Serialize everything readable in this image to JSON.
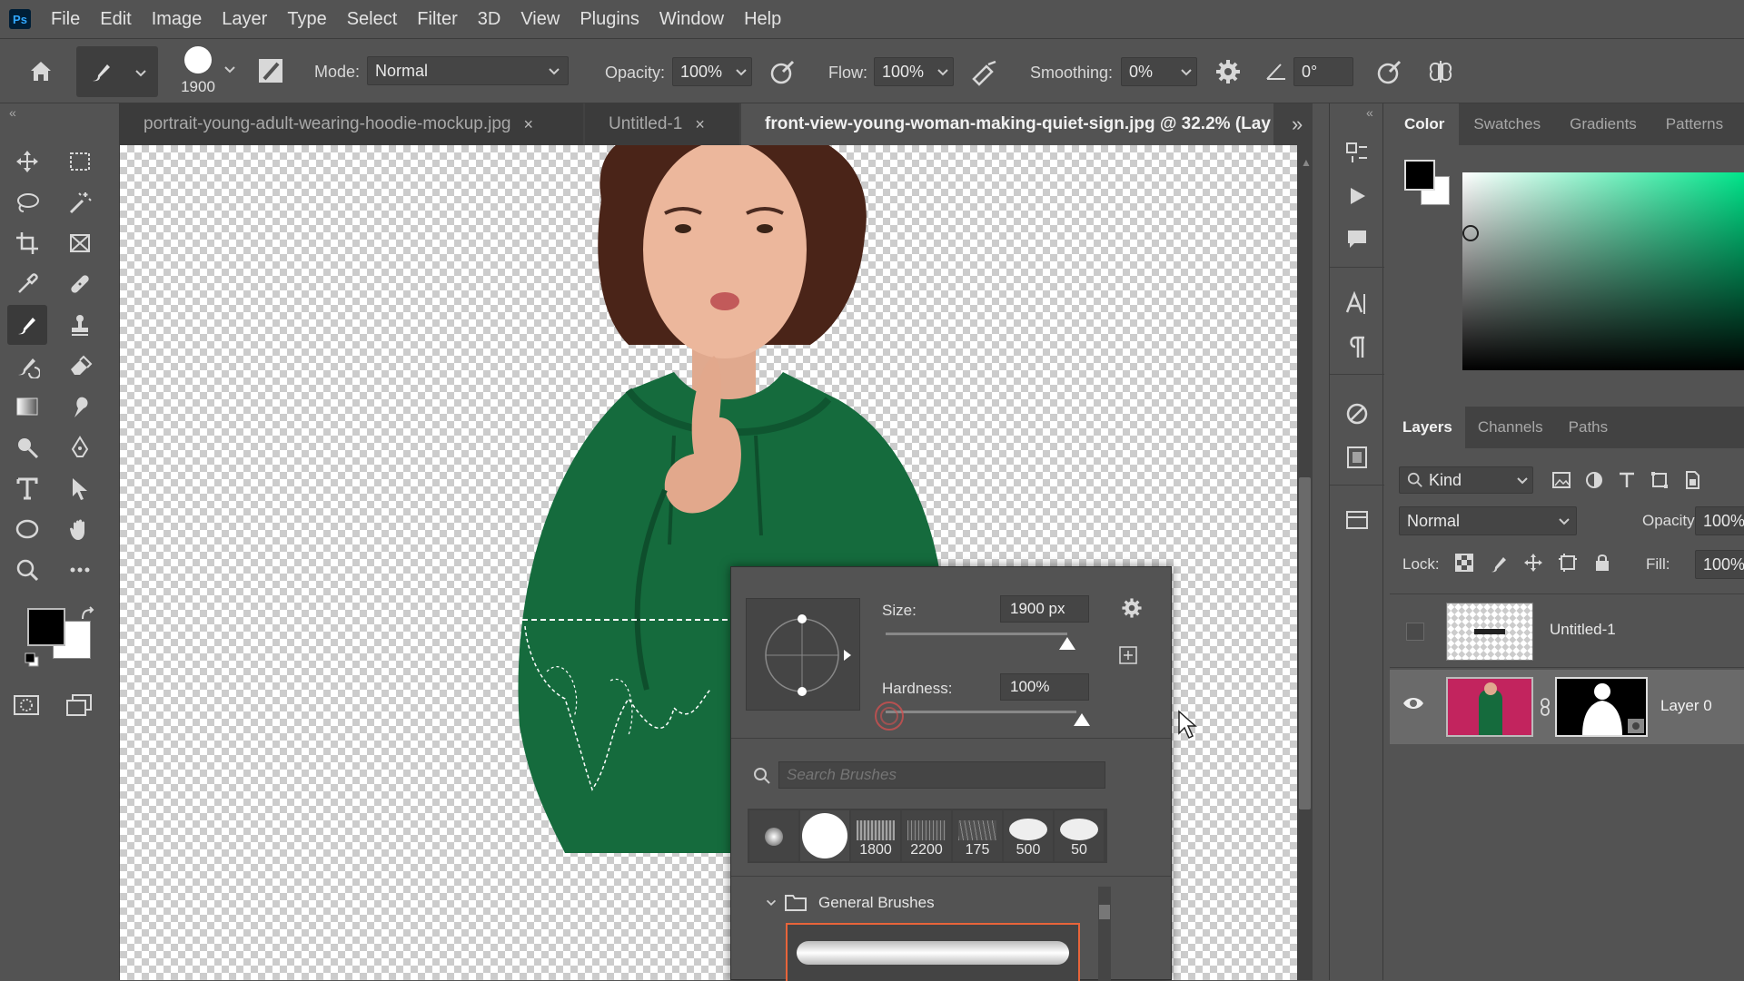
{
  "app": {
    "logo_text": "Ps"
  },
  "menu": [
    "File",
    "Edit",
    "Image",
    "Layer",
    "Type",
    "Select",
    "Filter",
    "3D",
    "View",
    "Plugins",
    "Window",
    "Help"
  ],
  "options": {
    "brush_size": "1900",
    "mode_label": "Mode:",
    "mode_value": "Normal",
    "opacity_label": "Opacity:",
    "opacity_value": "100%",
    "flow_label": "Flow:",
    "flow_value": "100%",
    "smoothing_label": "Smoothing:",
    "smoothing_value": "0%",
    "angle_value": "0°"
  },
  "tabs": [
    {
      "label": "portrait-young-adult-wearing-hoodie-mockup.jpg",
      "close": "×"
    },
    {
      "label": "Untitled-1",
      "close": "×"
    },
    {
      "label": "front-view-young-woman-making-quiet-sign.jpg @ 32.2% (Lay"
    }
  ],
  "brush_popup": {
    "size_label": "Size:",
    "size_value": "1900 px",
    "hardness_label": "Hardness:",
    "hardness_value": "100%",
    "search_placeholder": "Search Brushes",
    "presets": [
      "",
      "",
      "1800",
      "2200",
      "175",
      "500",
      "50"
    ],
    "group_label": "General Brushes"
  },
  "color_panel": {
    "tabs": [
      "Color",
      "Swatches",
      "Gradients",
      "Patterns"
    ],
    "foreground": "#000000",
    "background": "#ffffff",
    "hue_color": "#00e48a"
  },
  "layers_panel": {
    "tabs": [
      "Layers",
      "Channels",
      "Paths"
    ],
    "filter_kind": "Kind",
    "blend_mode": "Normal",
    "opacity_label": "Opacity:",
    "opacity_value": "100%",
    "lock_label": "Lock:",
    "fill_label": "Fill:",
    "fill_value": "100%",
    "layers": [
      {
        "name": "Untitled-1",
        "visible": false
      },
      {
        "name": "Layer 0",
        "visible": true
      }
    ]
  },
  "colors": {
    "hoodie_green": "#156b3d",
    "selected_brush_outline": "#e8643a"
  }
}
